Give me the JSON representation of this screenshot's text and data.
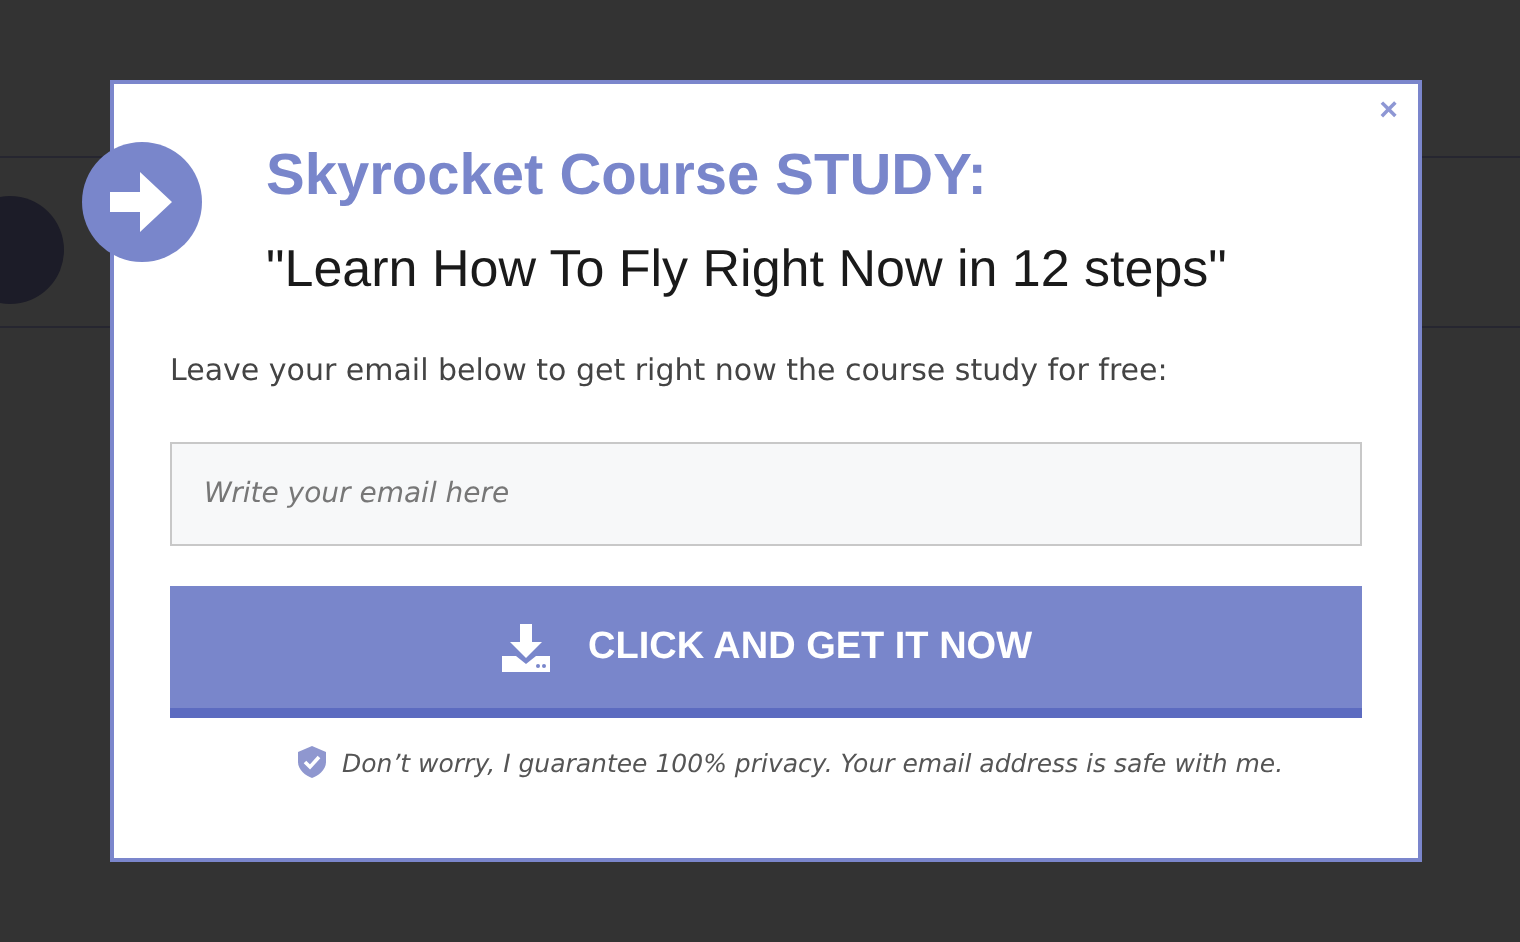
{
  "popup": {
    "close": "×",
    "title": "Skyrocket Course STUDY:",
    "subtitle": "\"Learn How To Fly Right Now in 12 steps\"",
    "description": "Leave your email below to get right now the course study for free:",
    "email_field": {
      "placeholder": "Write your email here"
    },
    "submit_button": "CLICK AND GET IT NOW",
    "privacy_note": "Don’t worry, I guarantee 100% privacy. Your email address is safe with me."
  }
}
